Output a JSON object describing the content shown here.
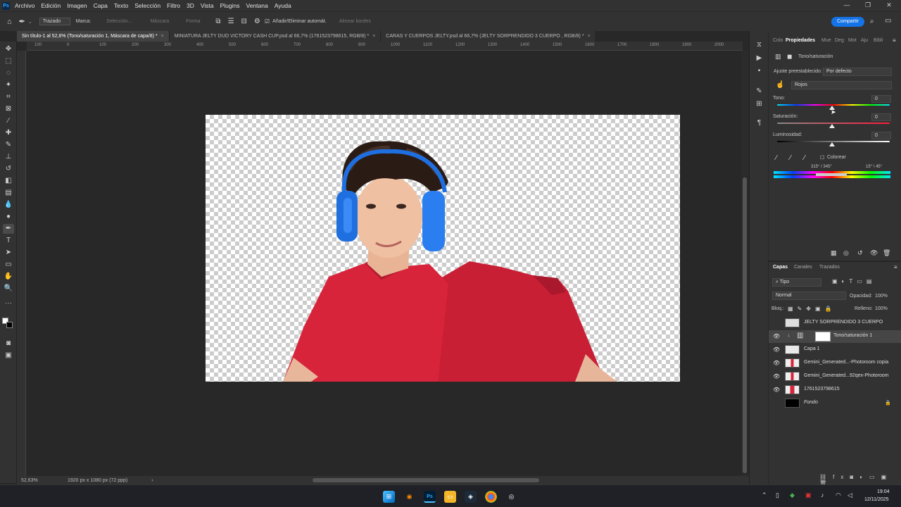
{
  "app": {
    "logo": "Ps"
  },
  "menu": [
    "Archivo",
    "Edición",
    "Imagen",
    "Capa",
    "Texto",
    "Selección",
    "Filtro",
    "3D",
    "Vista",
    "Plugins",
    "Ventana",
    "Ayuda"
  ],
  "options": {
    "mode_select": "Trazado",
    "marca": "Marca:",
    "seleccion": "Selección...",
    "mascara": "Máscara",
    "forma": "Forma",
    "add_remove": "Añadir/Eliminar automát.",
    "align_edges": "Alinear bordes",
    "share": "Compartir"
  },
  "tabs": [
    {
      "label": "Sin título-1 al 52,6% (Tono/saturación 1, Máscara de capa/8) *"
    },
    {
      "label": "MINIATURA JELTY DUO VICTORY CASH CUP.psd al 66,7% (1761523798615, RGB/8) *"
    },
    {
      "label": "CARAS Y CUERPOS JELTY.psd al 66,7% (JELTY SORPRENDIDO 3 CUERPO , RGB/8) *"
    }
  ],
  "ruler_marks": [
    "100",
    "0",
    "100",
    "200",
    "300",
    "400",
    "500",
    "600",
    "700",
    "800",
    "900",
    "1000",
    "1100",
    "1200",
    "1300",
    "1400",
    "1500",
    "1600",
    "1700",
    "1800",
    "1900",
    "2000"
  ],
  "status": {
    "zoom": "52,63%",
    "doc_size": "1920 px x 1080 px (72 ppp)"
  },
  "properties": {
    "tabs": [
      "Colo",
      "Propiedades",
      "Mue",
      "Deg",
      "Mot",
      "Aju",
      "Bibli"
    ],
    "adjustment_name": "Tono/saturación",
    "preset_label": "Ajuste preestablecido:",
    "preset_value": "Por defecto",
    "channel_value": "Rojos",
    "tono_label": "Tono:",
    "tono_value": "0",
    "saturacion_label": "Saturación:",
    "saturacion_value": "0",
    "luminosidad_label": "Luminosidad:",
    "luminosidad_value": "0",
    "colorear_label": "Colorear",
    "range_left": "315° / 345°",
    "range_right": "15° \\ 45°"
  },
  "layers_panel": {
    "tabs": [
      "Capas",
      "Canales",
      "Trazados"
    ],
    "filter": "Tipo",
    "blend_mode": "Normal",
    "opacity_label": "Opacidad:",
    "opacity_value": "100%",
    "lock_label": "Bloq.:",
    "fill_label": "Relleno:",
    "fill_value": "100%",
    "layers": [
      {
        "name": "JELTY SORPRENDIDO 3 CUERPO",
        "visible": false
      },
      {
        "name": "Tono/saturación 1",
        "visible": true,
        "selected": true
      },
      {
        "name": "Capa 1",
        "visible": true
      },
      {
        "name": "Gemini_Generated...-Photoroom copia",
        "visible": true
      },
      {
        "name": "Gemini_Generated...92qex-Photoroom",
        "visible": true
      },
      {
        "name": "1761523798615",
        "visible": true
      },
      {
        "name": "Fondo",
        "visible": false
      }
    ]
  },
  "taskbar": {
    "time": "19:04",
    "date": "12/11/2025"
  },
  "colors": {
    "accent": "#1473e6",
    "shirt": "#d8243a",
    "headphones": "#1f6fe0"
  }
}
